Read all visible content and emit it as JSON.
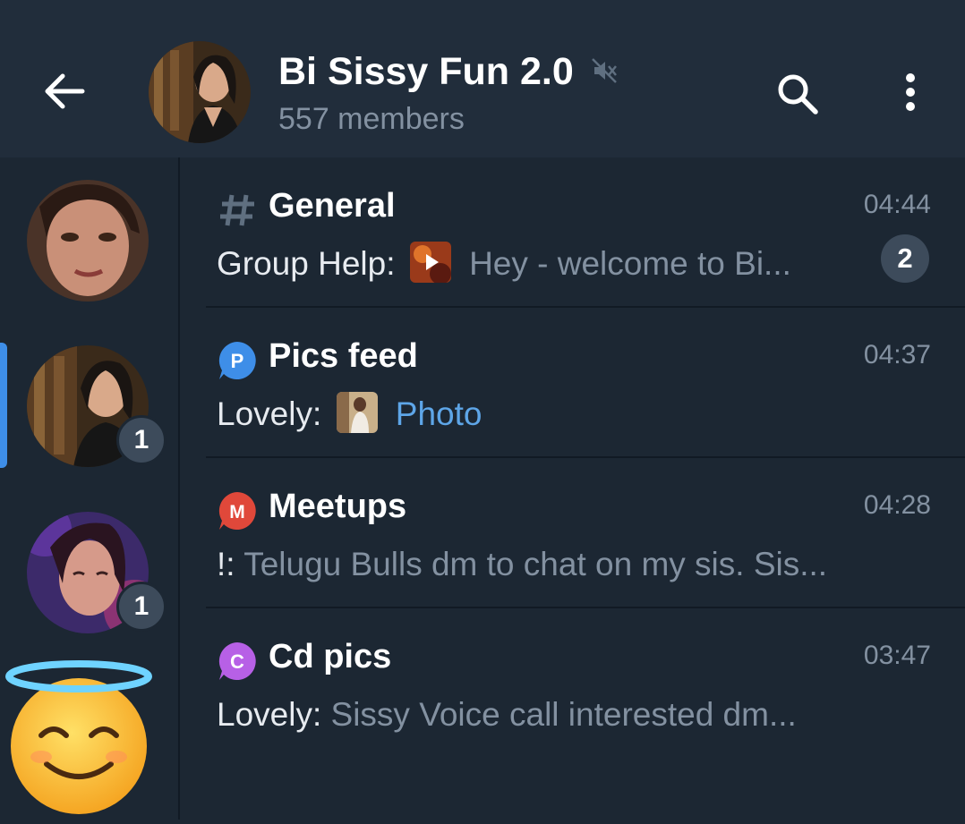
{
  "header": {
    "title": "Bi Sissy Fun 2.0",
    "subtitle": "557 members",
    "icons": [
      "back-arrow-icon",
      "muted-icon",
      "search-icon",
      "more-vert-icon"
    ]
  },
  "sidebar": {
    "items": [
      {
        "badge": ""
      },
      {
        "badge": "1",
        "active": true
      },
      {
        "badge": "1"
      },
      {
        "badge": ""
      }
    ]
  },
  "topics": [
    {
      "icon": "hash-icon",
      "name": "General",
      "time": "04:44",
      "sender": "Group Help:",
      "preview": "Hey - welcome to Bi...",
      "unread": "2"
    },
    {
      "icon": "topic-p-icon",
      "icon_letter": "P",
      "icon_color": "#3e8ee8",
      "name": "Pics feed",
      "time": "04:37",
      "sender": "Lovely:",
      "preview": "Photo"
    },
    {
      "icon": "topic-m-icon",
      "icon_letter": "M",
      "icon_color": "#e0483a",
      "name": "Meetups",
      "time": "04:28",
      "sender": "!:",
      "preview": "Telugu Bulls dm to chat on my sis. Sis..."
    },
    {
      "icon": "topic-c-icon",
      "icon_letter": "C",
      "icon_color": "#b760e6",
      "name": "Cd pics",
      "time": "03:47",
      "sender": "Lovely:",
      "preview": "Sissy Voice call interested dm..."
    }
  ],
  "colors": {
    "background": "#1c2733",
    "header": "#212d3b",
    "accent": "#3e8ee8",
    "muted_text": "#8391a1"
  }
}
